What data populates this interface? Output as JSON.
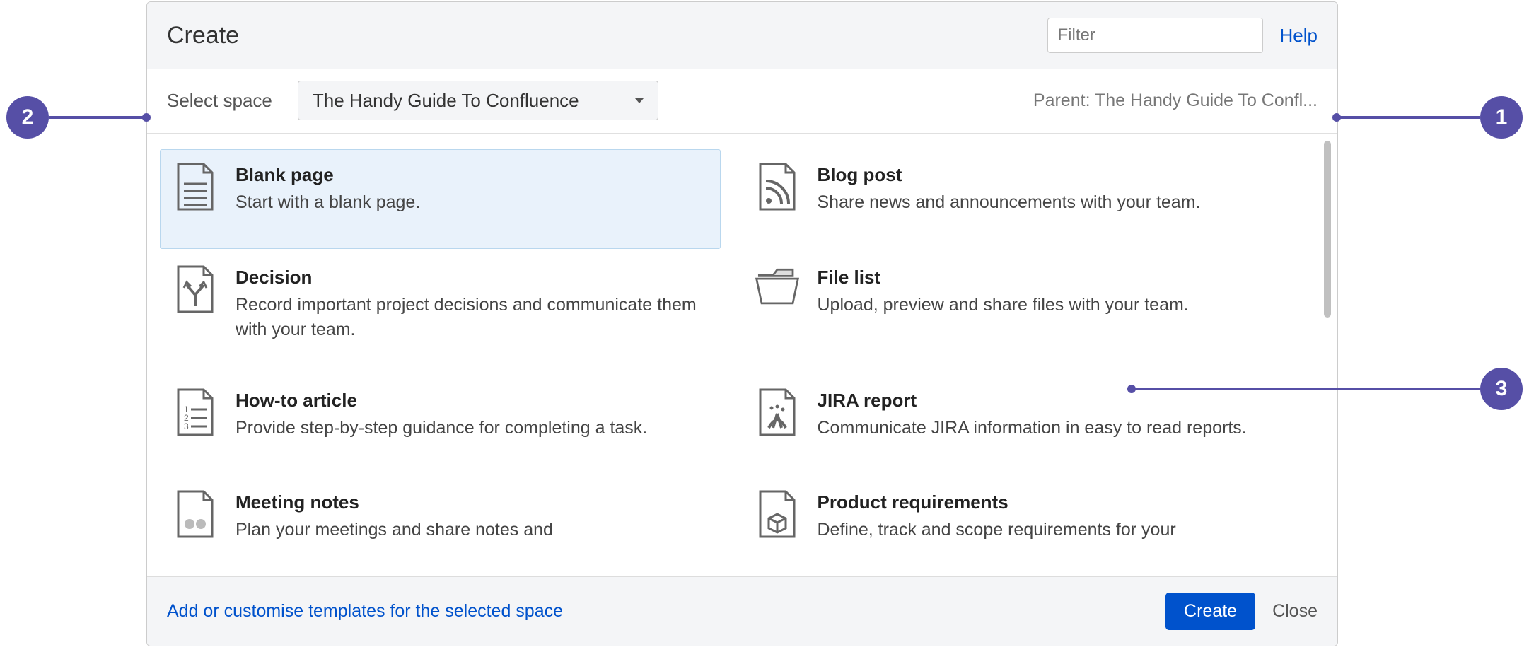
{
  "dialog": {
    "title": "Create",
    "filter_placeholder": "Filter",
    "help_label": "Help"
  },
  "space_row": {
    "label": "Select space",
    "selected_space": "The Handy Guide To Confluence",
    "parent_label": "Parent: The Handy Guide To Confl..."
  },
  "templates": [
    {
      "title": "Blank page",
      "desc": "Start with a blank page.",
      "selected": true,
      "icon": "document-blank-icon"
    },
    {
      "title": "Blog post",
      "desc": "Share news and announcements with your team.",
      "icon": "rss-icon"
    },
    {
      "title": "Decision",
      "desc": "Record important project decisions and communicate them with your team.",
      "icon": "decision-arrows-icon"
    },
    {
      "title": "File list",
      "desc": "Upload, preview and share files with your team.",
      "icon": "folder-icon"
    },
    {
      "title": "How-to article",
      "desc": "Provide step-by-step guidance for completing a task.",
      "icon": "numbered-list-icon"
    },
    {
      "title": "JIRA report",
      "desc": "Communicate JIRA information in easy to read reports.",
      "icon": "jira-report-icon"
    },
    {
      "title": "Meeting notes",
      "desc": "Plan your meetings and share notes and",
      "icon": "meeting-notes-icon"
    },
    {
      "title": "Product requirements",
      "desc": "Define, track and scope requirements for your",
      "icon": "product-req-icon"
    }
  ],
  "footer": {
    "customise_label": "Add or customise templates for the selected space",
    "create_label": "Create",
    "close_label": "Close"
  },
  "annotations": {
    "one": "1",
    "two": "2",
    "three": "3"
  }
}
